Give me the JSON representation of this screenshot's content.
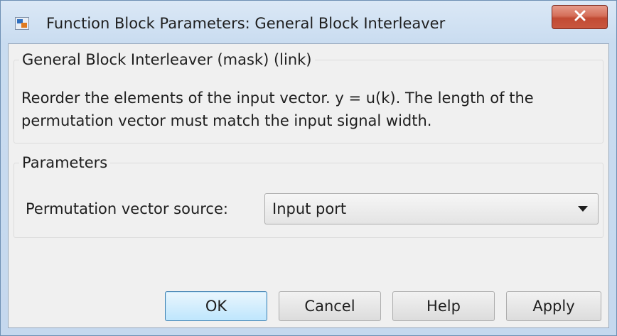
{
  "window": {
    "title": "Function Block Parameters: General Block Interleaver",
    "close_icon": "close-icon"
  },
  "block": {
    "heading": "General Block Interleaver (mask) (link)",
    "description": "Reorder the elements of the input vector. y = u(k). The length of the permutation vector must match the input signal width."
  },
  "parameters": {
    "heading": "Parameters",
    "permutation_source": {
      "label": "Permutation vector source:",
      "value": "Input port"
    }
  },
  "buttons": {
    "ok": "OK",
    "cancel": "Cancel",
    "help": "Help",
    "apply": "Apply"
  },
  "colors": {
    "close_button": "#c8573f",
    "default_button_border": "#3c7fb1",
    "window_frame": "#c9dcf0"
  }
}
